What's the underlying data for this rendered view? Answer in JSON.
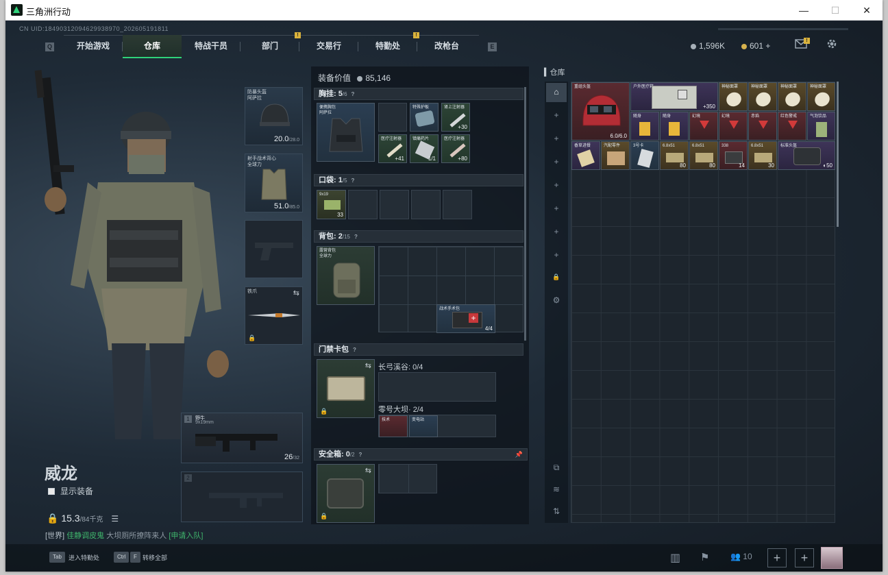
{
  "window": {
    "title": "三角洲行动",
    "controls": [
      "—",
      "☐",
      "✕"
    ]
  },
  "header": {
    "cnuid": "CN UID:18490312094629938970_202605191811",
    "nav_left_key": "Q",
    "nav_right_key": "E",
    "tabs": [
      {
        "label": "开始游戏",
        "active": false,
        "badge": ""
      },
      {
        "label": "仓库",
        "active": true,
        "badge": ""
      },
      {
        "label": "特战干员",
        "active": false,
        "badge": ""
      },
      {
        "label": "部门",
        "active": false,
        "badge": "!"
      },
      {
        "label": "交易行",
        "active": false,
        "badge": ""
      },
      {
        "label": "特勤处",
        "active": false,
        "badge": "!"
      },
      {
        "label": "改枪台",
        "active": false,
        "badge": ""
      }
    ],
    "silver": "1,596K",
    "gold": "601",
    "gold_plus": "+",
    "mail_badge": "!",
    "icons": [
      "mail-icon",
      "gear-icon"
    ]
  },
  "character": {
    "name": "威龙",
    "show_gear_label": "显示装备",
    "weight_value": "15.3",
    "weight_max": "/84千克",
    "chat_channel": "[世界]",
    "chat_user": "佳静调皮鬼",
    "chat_text": "大坝厕所撩阵来人",
    "chat_link": "[申请入队]"
  },
  "equip_slots": {
    "helmet": {
      "label": "防暴头盔\n阿萨拉",
      "value": "20.0",
      "max": "/28.0"
    },
    "armor": {
      "label": "射手战术背心\n全球力",
      "value": "51.0",
      "max": "/85.0"
    },
    "pistol": {
      "label": ""
    },
    "melee": {
      "label": "铁爪"
    },
    "primary1": {
      "num": "1",
      "label": "野牛",
      "sub": "9x19mm",
      "ammo": "26",
      "ammo_max": "/32"
    },
    "primary2": {
      "num": "2"
    }
  },
  "bottom": {
    "key1": "Tab",
    "key1_label": "进入特勤处",
    "key2a": "Ctrl",
    "key2b": "F",
    "key2_label": "转移全部",
    "squad_count": "10"
  },
  "loadout": {
    "value_label": "装备价值",
    "value": "85,146",
    "rig": {
      "title": "胸挂",
      "count": "5",
      "cap": "/6"
    },
    "rig_item_label": "便携胸包\n阿萨拉",
    "rig_items": [
      {
        "label": "",
        "count": ""
      },
      {
        "label": "特殊护板",
        "count": ""
      },
      {
        "label": "肾上注射器",
        "count": "30"
      },
      {
        "label": "医疗注射器",
        "count": "41"
      },
      {
        "label": "镇痛药片",
        "count": "1/1"
      },
      {
        "label": "医疗注射器",
        "count": "80"
      }
    ],
    "pocket": {
      "title": "口袋",
      "count": "1",
      "cap": "/5"
    },
    "pocket_item": {
      "label": "9x19",
      "count": "33"
    },
    "backpack": {
      "title": "背包",
      "count": "2",
      "cap": "/15"
    },
    "backpack_item_label": "露营背包\n全球力",
    "backpack_medkit": {
      "label": "战术手术包",
      "count": "4/4"
    },
    "keycard": {
      "title": "门禁卡包"
    },
    "key_row1": "长弓溪谷: 0/4",
    "key_row2": "零号大坝· 2/4",
    "key_row2_items": [
      "技术",
      "变电站"
    ],
    "safebox": {
      "title": "安全箱",
      "count": "0",
      "cap": "/2"
    }
  },
  "warehouse": {
    "title": "仓库",
    "row1": [
      {
        "label": "重组头盔",
        "count": "6.0/6.0",
        "type": "red"
      },
      {
        "label": "户外医疗箱",
        "count": "350",
        "type": "purple"
      },
      {
        "label": "神秘面罩",
        "count": "",
        "type": "gold"
      },
      {
        "label": "神秘面罩",
        "count": "",
        "type": "gold"
      },
      {
        "label": "神秘面罩",
        "count": "",
        "type": "gold"
      },
      {
        "label": "神秘面罩",
        "count": "",
        "type": "gold"
      }
    ],
    "row2": [
      {
        "label": "随身",
        "count": "",
        "type": "purple"
      },
      {
        "label": "随身",
        "count": "",
        "type": "purple"
      },
      {
        "label": "幻境",
        "count": "",
        "type": "red"
      },
      {
        "label": "幻境",
        "count": "",
        "type": "red"
      },
      {
        "label": "赤焰",
        "count": "",
        "type": "red"
      },
      {
        "label": "红色警戒",
        "count": "",
        "type": "red"
      },
      {
        "label": "气泡饮品",
        "count": "",
        "type": "purple"
      }
    ],
    "row3": [
      {
        "label": "香草进餐",
        "count": "",
        "type": "purple"
      },
      {
        "label": "汽配零件",
        "count": "",
        "type": "gold"
      },
      {
        "label": "3号卡",
        "count": "",
        "type": "blue"
      },
      {
        "label": "6.8x51",
        "count": "80",
        "type": "gold"
      },
      {
        "label": "6.8x51",
        "count": "80",
        "type": "gold"
      },
      {
        "label": "338",
        "count": "14",
        "type": "red"
      },
      {
        "label": "6.8x51",
        "count": "30",
        "type": "gold"
      },
      {
        "label": "标准头盔",
        "count": "50",
        "type": "purple"
      }
    ]
  }
}
